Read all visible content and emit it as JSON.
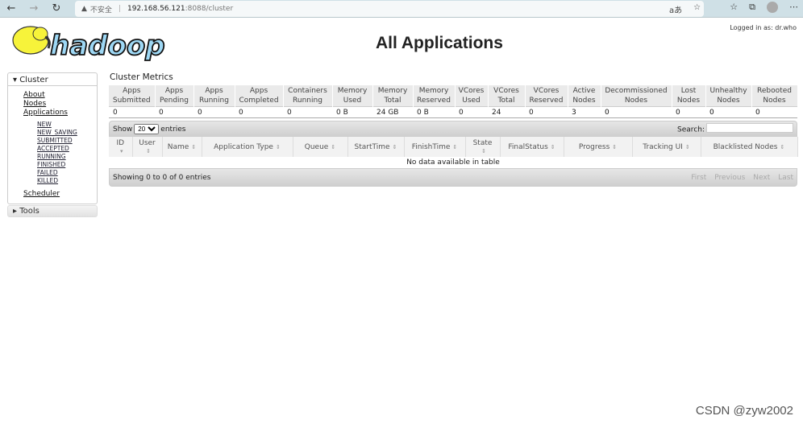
{
  "browser": {
    "warning": "不安全",
    "url_host": "192.168.56.121",
    "url_rest": ":8088/cluster"
  },
  "header": {
    "title": "All Applications",
    "logged_in": "Logged in as: dr.who",
    "logo_text": "hadoop"
  },
  "sidebar": {
    "cluster_label": "Cluster",
    "items": [
      "About",
      "Nodes",
      "Applications"
    ],
    "states": [
      "NEW",
      "NEW_SAVING",
      "SUBMITTED",
      "ACCEPTED",
      "RUNNING",
      "FINISHED",
      "FAILED",
      "KILLED"
    ],
    "scheduler": "Scheduler",
    "tools_label": "Tools"
  },
  "metrics": {
    "title": "Cluster Metrics",
    "headers": [
      [
        "Apps",
        "Submitted"
      ],
      [
        "Apps",
        "Pending"
      ],
      [
        "Apps",
        "Running"
      ],
      [
        "Apps",
        "Completed"
      ],
      [
        "Containers",
        "Running"
      ],
      [
        "Memory",
        "Used"
      ],
      [
        "Memory",
        "Total"
      ],
      [
        "Memory",
        "Reserved"
      ],
      [
        "VCores",
        "Used"
      ],
      [
        "VCores",
        "Total"
      ],
      [
        "VCores",
        "Reserved"
      ],
      [
        "Active",
        "Nodes"
      ],
      [
        "Decommissioned",
        "Nodes"
      ],
      [
        "Lost",
        "Nodes"
      ],
      [
        "Unhealthy",
        "Nodes"
      ],
      [
        "Rebooted",
        "Nodes"
      ]
    ],
    "values": [
      "0",
      "0",
      "0",
      "0",
      "0",
      "0 B",
      "24 GB",
      "0 B",
      "0",
      "24",
      "0",
      "3",
      "0",
      "0",
      "0",
      "0"
    ]
  },
  "apps": {
    "show": "Show",
    "page_size": "20",
    "entries": "entries",
    "search_label": "Search:",
    "search_value": "",
    "columns": [
      "ID",
      "User",
      "Name",
      "Application Type",
      "Queue",
      "StartTime",
      "FinishTime",
      "State",
      "FinalStatus",
      "Progress",
      "Tracking UI",
      "Blacklisted Nodes"
    ],
    "empty": "No data available in table",
    "info": "Showing 0 to 0 of 0 entries",
    "pager": [
      "First",
      "Previous",
      "Next",
      "Last"
    ]
  },
  "watermark": "CSDN @zyw2002"
}
